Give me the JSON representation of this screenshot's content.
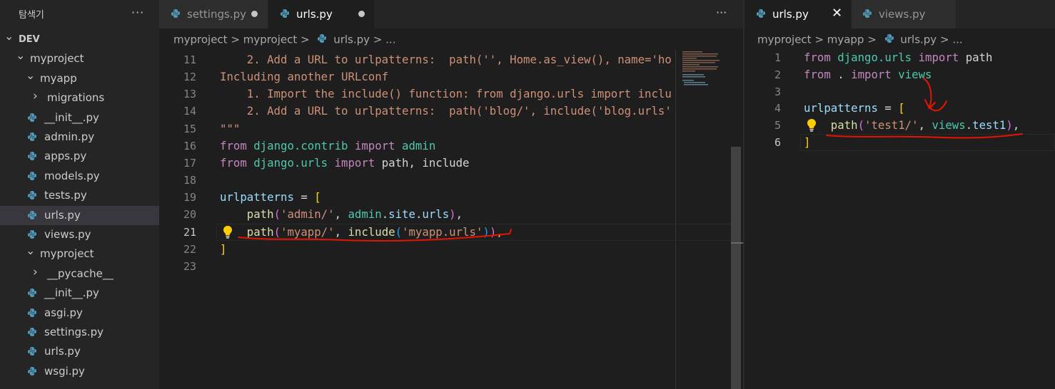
{
  "explorer": {
    "title": "탐색기",
    "more": "···",
    "items": [
      {
        "label": "DEV",
        "kind": "root"
      },
      {
        "label": "myproject",
        "kind": "folder-open"
      },
      {
        "label": "myapp",
        "kind": "folder-open"
      },
      {
        "label": "migrations",
        "kind": "folder-closed"
      },
      {
        "label": "__init__.py",
        "kind": "file"
      },
      {
        "label": "admin.py",
        "kind": "file"
      },
      {
        "label": "apps.py",
        "kind": "file"
      },
      {
        "label": "models.py",
        "kind": "file"
      },
      {
        "label": "tests.py",
        "kind": "file"
      },
      {
        "label": "urls.py",
        "kind": "file",
        "selected": true
      },
      {
        "label": "views.py",
        "kind": "file"
      },
      {
        "label": "myproject",
        "kind": "folder-open"
      },
      {
        "label": "__pycache__",
        "kind": "folder-closed"
      },
      {
        "label": "__init__.py",
        "kind": "file"
      },
      {
        "label": "asgi.py",
        "kind": "file"
      },
      {
        "label": "settings.py",
        "kind": "file"
      },
      {
        "label": "urls.py",
        "kind": "file"
      },
      {
        "label": "wsgi.py",
        "kind": "file"
      }
    ]
  },
  "left_editor": {
    "tabs": [
      {
        "label": "settings.py",
        "modified": true
      },
      {
        "label": "urls.py",
        "modified": true,
        "active": true
      }
    ],
    "more": "···",
    "breadcrumb": [
      "myproject",
      ">",
      "myproject",
      ">",
      "urls.py",
      ">",
      "..."
    ],
    "current_line": "21"
  },
  "right_editor": {
    "tabs": [
      {
        "label": "urls.py",
        "active": true
      },
      {
        "label": "views.py"
      }
    ],
    "breadcrumb": [
      "myproject",
      ">",
      "myapp",
      ">",
      "urls.py",
      ">",
      "..."
    ],
    "current_line": "6"
  },
  "left_code": [
    {
      "n": "11",
      "tokens": [
        [
          "    2. Add a URL to urlpatterns:  path('', Home.as_view(), name='ho",
          "str"
        ]
      ]
    },
    {
      "n": "12",
      "tokens": [
        [
          "Including another URLconf",
          "str"
        ]
      ]
    },
    {
      "n": "13",
      "tokens": [
        [
          "    1. Import the include() function: from django.urls import inclu",
          "str"
        ]
      ]
    },
    {
      "n": "14",
      "tokens": [
        [
          "    2. Add a URL to urlpatterns:  path('blog/', include('blog.urls'",
          "str"
        ]
      ]
    },
    {
      "n": "15",
      "tokens": [
        [
          "\"\"\"",
          "str"
        ]
      ]
    },
    {
      "n": "16",
      "tokens": [
        [
          "from",
          "kw"
        ],
        [
          " ",
          "def"
        ],
        [
          "django.contrib",
          "mod"
        ],
        [
          " ",
          "def"
        ],
        [
          "import",
          "kw"
        ],
        [
          " ",
          "def"
        ],
        [
          "admin",
          "mod"
        ]
      ]
    },
    {
      "n": "17",
      "tokens": [
        [
          "from",
          "kw"
        ],
        [
          " ",
          "def"
        ],
        [
          "django.urls",
          "mod"
        ],
        [
          " ",
          "def"
        ],
        [
          "import",
          "kw"
        ],
        [
          " path, include",
          "def"
        ]
      ]
    },
    {
      "n": "18",
      "tokens": []
    },
    {
      "n": "19",
      "tokens": [
        [
          "urlpatterns",
          "var"
        ],
        [
          " = ",
          "def"
        ],
        [
          "[",
          "br1"
        ]
      ]
    },
    {
      "n": "20",
      "tokens": [
        [
          "    ",
          "def"
        ],
        [
          "path",
          "fn"
        ],
        [
          "(",
          "br2"
        ],
        [
          "'admin/'",
          "str"
        ],
        [
          ", ",
          "def"
        ],
        [
          "admin",
          "mod"
        ],
        [
          ".",
          "def"
        ],
        [
          "site",
          "var"
        ],
        [
          ".",
          "def"
        ],
        [
          "urls",
          "var"
        ],
        [
          ")",
          "br2"
        ],
        [
          ",",
          "def"
        ]
      ]
    },
    {
      "n": "21",
      "tokens": [
        [
          "    ",
          "def"
        ],
        [
          "path",
          "fn"
        ],
        [
          "(",
          "br2"
        ],
        [
          "'myapp/'",
          "str"
        ],
        [
          ", ",
          "def"
        ],
        [
          "include",
          "fn"
        ],
        [
          "(",
          "br3"
        ],
        [
          "'myapp.urls'",
          "str"
        ],
        [
          ")",
          "br3"
        ],
        [
          ")",
          "br2"
        ],
        [
          ",",
          "def"
        ]
      ]
    },
    {
      "n": "22",
      "tokens": [
        [
          "]",
          "br1"
        ]
      ]
    },
    {
      "n": "23",
      "tokens": []
    }
  ],
  "right_code": [
    {
      "n": "1",
      "tokens": [
        [
          "from",
          "kw"
        ],
        [
          " ",
          "def"
        ],
        [
          "django.urls",
          "mod"
        ],
        [
          " ",
          "def"
        ],
        [
          "import",
          "kw"
        ],
        [
          " path",
          "def"
        ]
      ]
    },
    {
      "n": "2",
      "tokens": [
        [
          "from",
          "kw"
        ],
        [
          " . ",
          "def"
        ],
        [
          "import",
          "kw"
        ],
        [
          " ",
          "def"
        ],
        [
          "views",
          "mod"
        ]
      ]
    },
    {
      "n": "3",
      "tokens": []
    },
    {
      "n": "4",
      "tokens": [
        [
          "urlpatterns",
          "var"
        ],
        [
          " = ",
          "def"
        ],
        [
          "[",
          "br1"
        ]
      ]
    },
    {
      "n": "5",
      "tokens": [
        [
          "    ",
          "def"
        ],
        [
          "path",
          "fn"
        ],
        [
          "(",
          "br2"
        ],
        [
          "'test1/'",
          "str"
        ],
        [
          ", ",
          "def"
        ],
        [
          "views",
          "mod"
        ],
        [
          ".",
          "def"
        ],
        [
          "test1",
          "var"
        ],
        [
          ")",
          "br2"
        ],
        [
          ",",
          "def"
        ]
      ]
    },
    {
      "n": "6",
      "tokens": [
        [
          "]",
          "br1"
        ]
      ]
    }
  ],
  "colors": {
    "annotation": "#e51400",
    "lightbulb": "#ffcc00",
    "python_blue": "#519aba"
  }
}
